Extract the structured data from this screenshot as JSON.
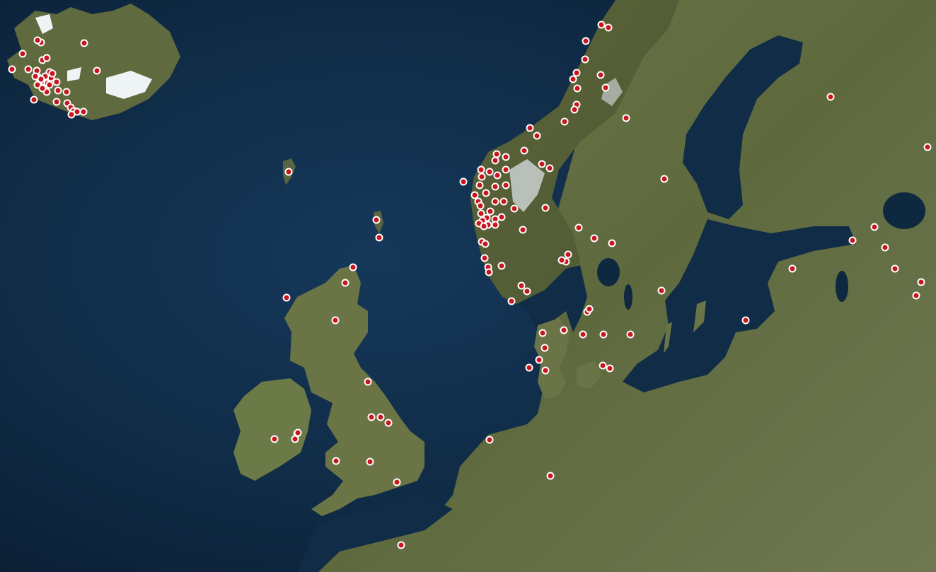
{
  "map": {
    "view": "satellite",
    "region": "Northern Europe",
    "colors": {
      "ocean": "#0f2a44",
      "ocean_deep": "#0a1c31",
      "land": "#5c6a3c",
      "land_light": "#7a7d55",
      "snow": "#e8eef2",
      "marker_fill": "#c8161d",
      "marker_stroke": "#ffffff"
    },
    "marker_counts": {
      "iceland": 34,
      "norway": 64,
      "faroe_shetland_scotland": 7,
      "ireland_uk": 12,
      "denmark_germany_nl": 14,
      "sweden_finland_baltic": 13,
      "france": 1
    }
  }
}
